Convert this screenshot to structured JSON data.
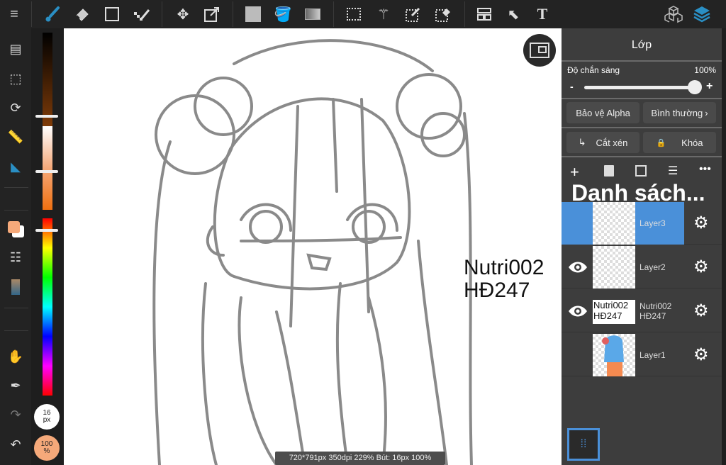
{
  "toolbar": {
    "icons": [
      "menu-icon",
      "brush-icon",
      "eraser-icon",
      "shape-icon",
      "dot-pen-icon",
      "move-icon",
      "transform-icon",
      "fill-color-icon",
      "bucket-icon",
      "gradient-icon",
      "select-rect-icon",
      "magic-wand-icon",
      "select-pen-icon",
      "select-eraser-icon",
      "layout-icon",
      "select-cursor-icon",
      "text-icon",
      "3d-icon",
      "layers-icon"
    ],
    "text_tool": "T"
  },
  "brush": {
    "size_value": "16",
    "size_unit": "px",
    "opacity_value": "100",
    "opacity_unit": "%"
  },
  "colors": {
    "accent": "#4a90d9",
    "primary": "#f5a97a",
    "active_tool": "#2a8fc4"
  },
  "canvas": {
    "watermark_line1": "Nutri002",
    "watermark_line2": "HĐ247",
    "status": "720*791px 350dpi 229% Bút: 16px 100%"
  },
  "panel": {
    "title": "Lớp",
    "opacity_label": "Độ chắn sáng",
    "opacity_value": "100%",
    "opacity_fraction": 1.0,
    "minus": "-",
    "plus": "+",
    "alpha_protect": "Bảo vệ Alpha",
    "blend_mode": "Bình thường",
    "clipping": "Cắt xén",
    "lock": "Khóa",
    "list_title": "Danh sách...",
    "layers": [
      {
        "name": "Layer3",
        "selected": true,
        "visible": false
      },
      {
        "name": "Layer2",
        "selected": false,
        "visible": true
      },
      {
        "name": "Nutri002 HĐ247",
        "thumb_line1": "Nutri002",
        "thumb_line2": "HĐ247",
        "selected": false,
        "visible": true
      },
      {
        "name": "Layer1",
        "selected": false,
        "visible": false
      }
    ]
  }
}
